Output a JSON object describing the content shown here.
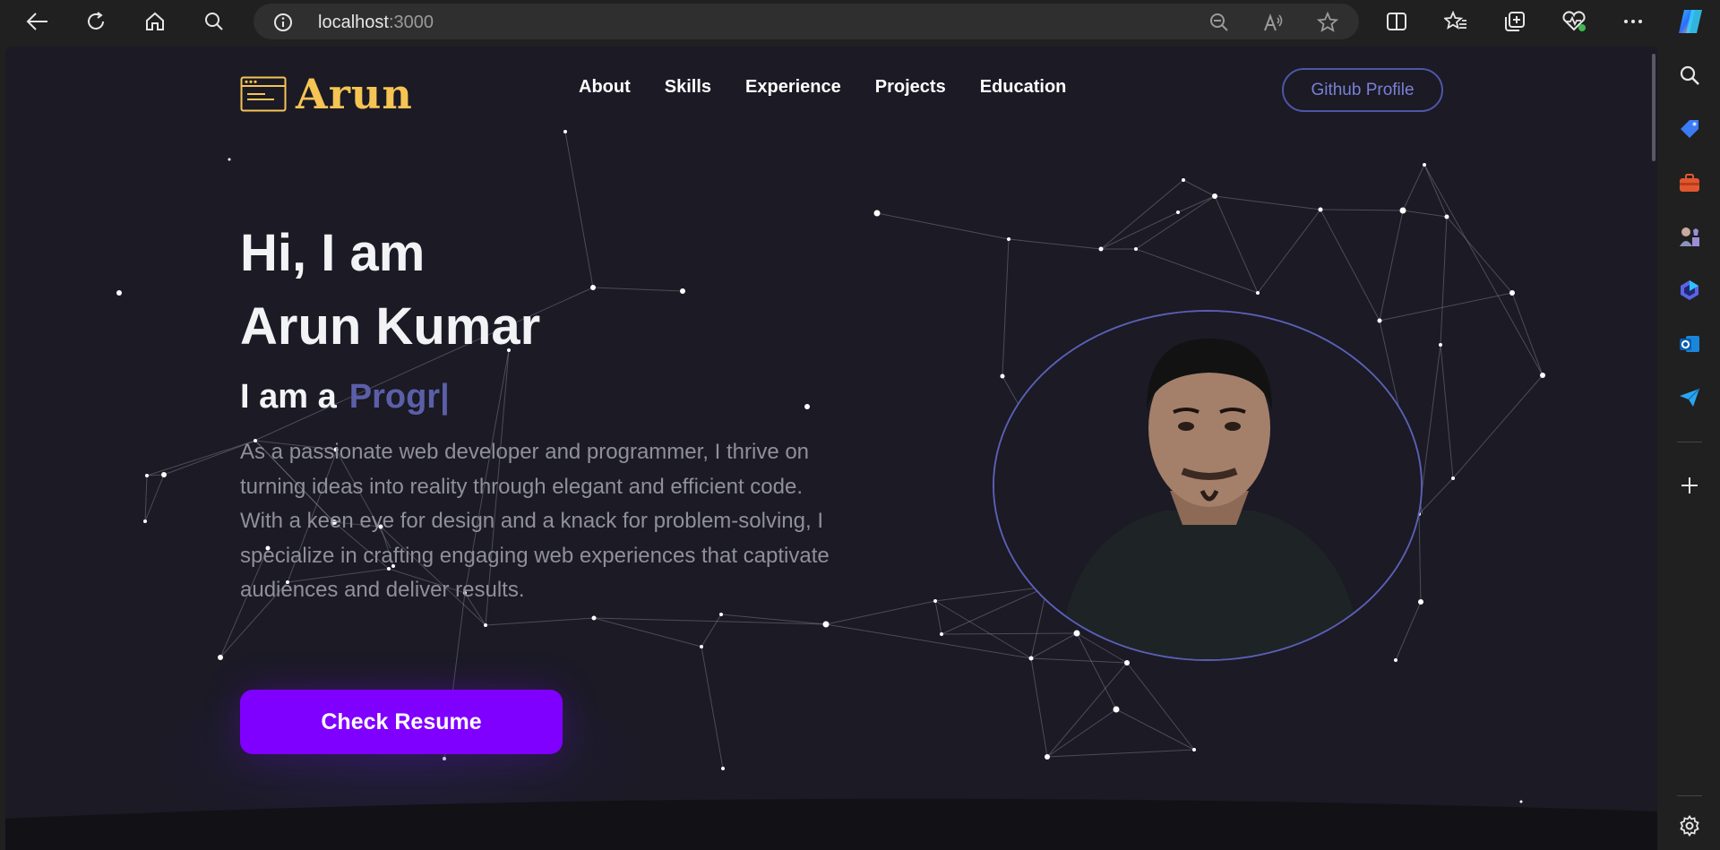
{
  "browser": {
    "url_host": "localhost",
    "url_port": ":3000"
  },
  "site": {
    "logo_text": "Arun",
    "menu": [
      "About",
      "Skills",
      "Experience",
      "Projects",
      "Education"
    ],
    "github_label": "Github Profile"
  },
  "hero": {
    "greeting_line1": "Hi, I am",
    "greeting_line2": "Arun Kumar",
    "role_prefix": "I am a",
    "role_typed": "Progr|",
    "bio": "As a passionate web developer and programmer, I thrive on turning ideas into reality through elegant and efficient code. With a keen eye for design and a knack for problem-solving, I specialize in crafting engaging web experiences that captivate audiences and deliver results.",
    "resume_label": "Check Resume"
  },
  "colors": {
    "page_bg": "#1b1a25",
    "logo": "#f6c453",
    "accent_purple": "#8000ff",
    "role_text": "#5b5fa8",
    "ring": "#5a5fb4"
  },
  "icons": {
    "browser": [
      "back-icon",
      "refresh-icon",
      "home-icon",
      "search-icon",
      "info-icon",
      "zoom-out-icon",
      "read-aloud-icon",
      "favorite-star-icon",
      "split-screen-icon",
      "favorites-icon",
      "collections-icon",
      "browser-essentials-icon",
      "more-icon",
      "copilot-icon"
    ],
    "sidebar": [
      "sidebar-search-icon",
      "shopping-tag-icon",
      "tools-icon",
      "games-icon",
      "microsoft365-icon",
      "outlook-icon",
      "send-icon",
      "add-icon",
      "settings-icon"
    ]
  }
}
